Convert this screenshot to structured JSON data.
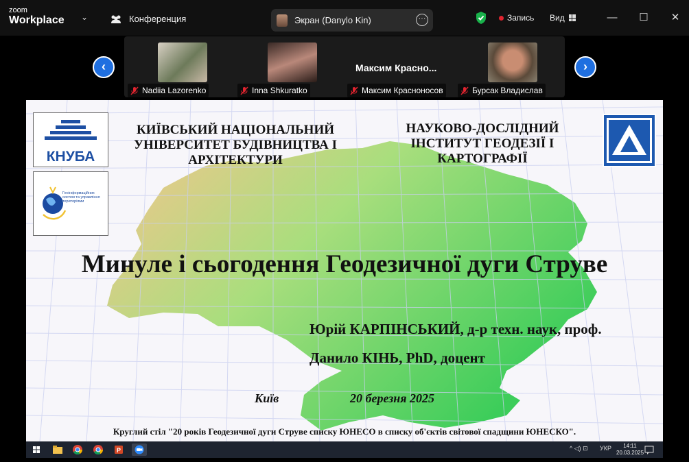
{
  "app": {
    "logo_line1": "zoom",
    "logo_line2": "Workplace",
    "conference_label": "Конференция",
    "screen_share_label": "Экран (Danylo Kin)",
    "record_label": "Запись",
    "view_label": "Вид",
    "icons": {
      "chevron": "chevron-down-icon",
      "conference": "people-icon",
      "more": "ellipsis-icon",
      "security": "shield-check-icon",
      "record": "record-dot-icon",
      "view": "grid-icon",
      "minimize": "minimize-icon",
      "maximize": "maximize-icon",
      "close": "close-icon"
    },
    "window_glyphs": {
      "minimize": "—",
      "maximize": "☐",
      "close": "✕"
    },
    "colors": {
      "accent": "#1f6fe0",
      "record": "#e0242f",
      "shield": "#19b24b"
    }
  },
  "gallery": {
    "prev_glyph": "‹",
    "next_glyph": "›",
    "participants": [
      {
        "name": "Nadiia Lazorenko",
        "muted": true
      },
      {
        "name": "Inna Shkuratko",
        "muted": true
      },
      {
        "name": "Максим Красноносов",
        "video_label": "Максим  Красно...",
        "muted": true
      },
      {
        "name": "Бурсак Владислав",
        "muted": true
      }
    ]
  },
  "slide": {
    "logo_knuba_text": "КНУБА",
    "logo_gis_text": "Геоінформаційних систем та управління територіями",
    "heading_left": [
      "КИЇВСЬКИЙ НАЦІОНАЛЬНИЙ",
      "УНІВЕРСИТЕТ БУДІВНИЦТВА І",
      "АРХІТЕКТУРИ"
    ],
    "heading_right": [
      "НАУКОВО-ДОСЛІДНИЙ",
      "ІНСТИТУТ ГЕОДЕЗІЇ І",
      "КАРТОГРАФІЇ"
    ],
    "title": "Минуле і сьогодення Геодезичної дуги Струве",
    "author1": "Юрій КАРПІНСЬКИЙ, д-р техн. наук, проф.",
    "author2": "Данило КІНЬ, PhD, доцент",
    "city": "Київ",
    "date": "20 березня 2025",
    "footer": "Круглий стіл \"20 років Геодезичної дуги Струве списку ЮНЕСО в списку об'єктів світової спадщини ЮНЕСКО\"."
  },
  "taskbar": {
    "icons": [
      "windows-start-icon",
      "file-explorer-icon",
      "chrome-icon",
      "chrome-icon",
      "powerpoint-icon",
      "zoom-icon"
    ],
    "language": "УКР",
    "time": "14:11",
    "date": "20.03.2025",
    "tray_glyphs": "^ ◁) ⊡"
  }
}
